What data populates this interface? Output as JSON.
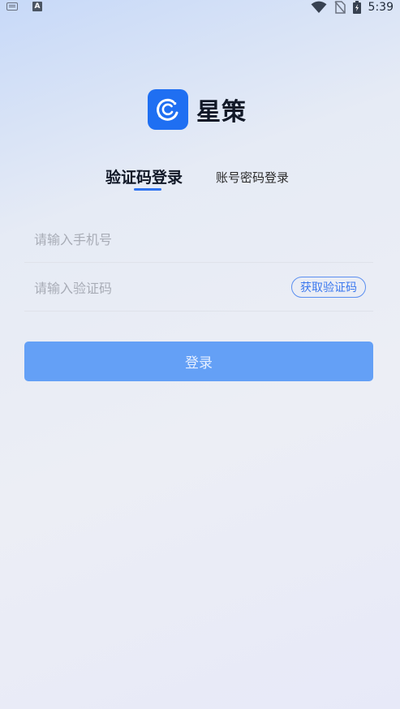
{
  "status_bar": {
    "time": "5:39",
    "notification_icons": [
      "keyboard-icon",
      "a-icon"
    ],
    "a_label": "A",
    "system_icons": [
      "wifi-icon",
      "no-sim-icon",
      "battery-charging-icon"
    ]
  },
  "app": {
    "name": "星策",
    "logo_icon": "logo-icon",
    "brand_color": "#1f6ff2"
  },
  "tabs": {
    "active": "验证码登录",
    "inactive": "账号密码登录"
  },
  "form": {
    "phone_placeholder": "请输入手机号",
    "code_placeholder": "请输入验证码",
    "get_code_label": "获取验证码",
    "login_label": "登录",
    "button_color": "#64a0f6",
    "accent_color": "#2f73f0"
  }
}
